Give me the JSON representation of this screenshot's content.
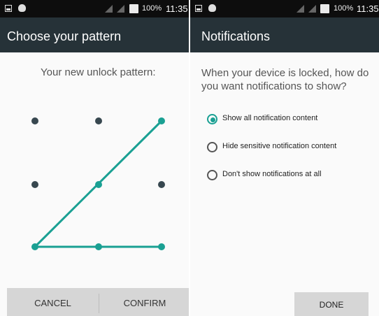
{
  "status_bar": {
    "battery": "100%",
    "time": "11:35"
  },
  "left_screen": {
    "title": "Choose your pattern",
    "pattern_label": "Your new unlock pattern:",
    "buttons": {
      "cancel": "CANCEL",
      "confirm": "CONFIRM"
    }
  },
  "right_screen": {
    "title": "Notifications",
    "question": "When your device is locked, how do you want notifications to show?",
    "options": [
      {
        "label": "Show all notification content",
        "checked": true
      },
      {
        "label": "Hide sensitive notification content",
        "checked": false
      },
      {
        "label": "Don't show notifications at all",
        "checked": false
      }
    ],
    "done": "DONE"
  },
  "colors": {
    "appbar": "#263238",
    "accent": "#1aa093",
    "dot": "#37474f",
    "button_bar": "#d6d6d6"
  }
}
